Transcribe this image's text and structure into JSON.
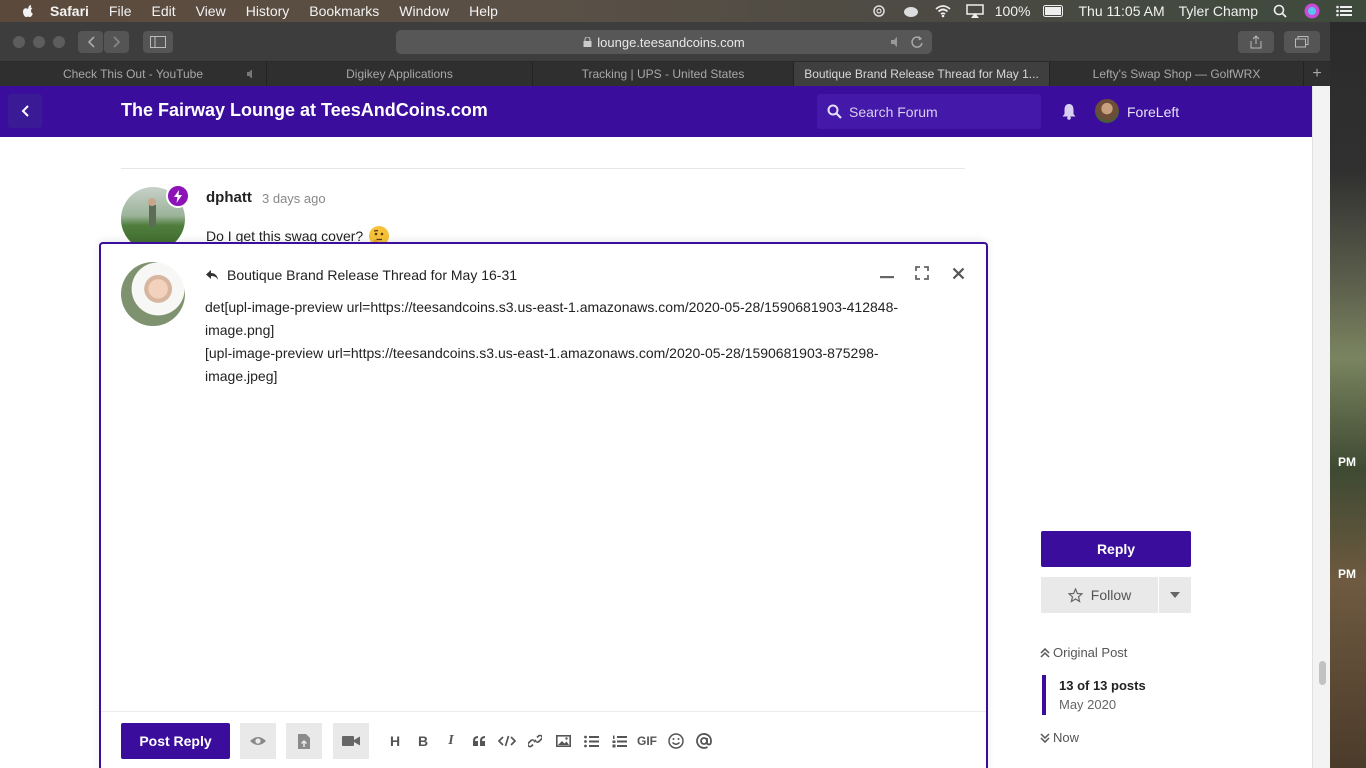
{
  "menubar": {
    "items": [
      "Safari",
      "File",
      "Edit",
      "View",
      "History",
      "Bookmarks",
      "Window",
      "Help"
    ],
    "battery": "100%",
    "clock": "Thu 11:05 AM",
    "user": "Tyler Champ"
  },
  "browser": {
    "url": "lounge.teesandcoins.com",
    "tabs": [
      {
        "label": "Check This Out - YouTube"
      },
      {
        "label": "Digikey Applications"
      },
      {
        "label": "Tracking | UPS - United States"
      },
      {
        "label": "Boutique Brand Release Thread for May 1..."
      },
      {
        "label": "Lefty's Swap Shop — GolfWRX"
      }
    ],
    "new_tab": "+"
  },
  "header": {
    "title": "The Fairway Lounge at TeesAndCoins.com",
    "search_placeholder": "Search Forum",
    "username": "ForeLeft"
  },
  "post": {
    "author": "dphatt",
    "time": "3 days ago",
    "text": "Do I get this swag cover?"
  },
  "sidebar": {
    "reply_label": "Reply",
    "follow_label": "Follow",
    "original_post": "Original Post",
    "posts_count": "13 of 13 posts",
    "posts_date": "May 2020",
    "now": "Now"
  },
  "composer": {
    "title": "Boutique Brand Release Thread for May 16-31",
    "lines": [
      "det[upl-image-preview url=https://teesandcoins.s3.us-east-1.amazonaws.com/2020-05-28/1590681903-412848-",
      "image.png]",
      "[upl-image-preview url=https://teesandcoins.s3.us-east-1.amazonaws.com/2020-05-28/1590681903-875298-",
      "image.jpeg]"
    ],
    "post_reply_label": "Post Reply",
    "format": {
      "heading": "H",
      "bold": "B",
      "italic": "I",
      "gif": "GIF"
    }
  },
  "desktop": {
    "time1": "PM",
    "time2": "PM"
  },
  "colors": {
    "brand": "#3b0d9c",
    "badge": "#8d12b8"
  }
}
